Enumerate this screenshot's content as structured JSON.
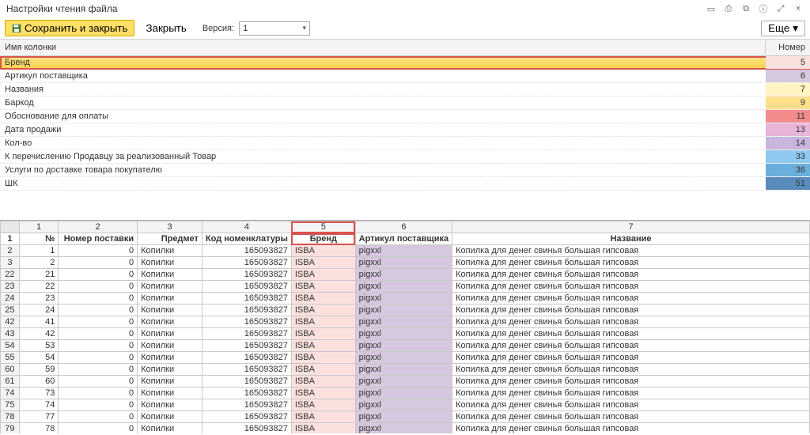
{
  "title": "Настройки чтения файла",
  "toolbar": {
    "save_label": "Сохранить и закрыть",
    "close_label": "Закрыть",
    "version_label": "Версия:",
    "version_value": "1",
    "more_label": "Еще"
  },
  "upper": {
    "header_name": "Имя колонки",
    "header_num": "Номер",
    "rows": [
      {
        "name": "Бренд",
        "num": 5,
        "color": "#fbe1de",
        "selected": true
      },
      {
        "name": "Артикул поставщика",
        "num": 6,
        "color": "#d6c8de"
      },
      {
        "name": "Названия",
        "num": 7,
        "color": "#fff4c2"
      },
      {
        "name": "Баркод",
        "num": 9,
        "color": "#ffe08a"
      },
      {
        "name": "Обоснование для оплаты",
        "num": 11,
        "color": "#f28c8c"
      },
      {
        "name": "Дата продажи",
        "num": 13,
        "color": "#e8b4d8"
      },
      {
        "name": "Кол-во",
        "num": 14,
        "color": "#c8b6de"
      },
      {
        "name": "К перечислению Продавцу за реализованный Товар",
        "num": 33,
        "color": "#8fc9f0"
      },
      {
        "name": "Услуги по доставке товара покупателю",
        "num": 36,
        "color": "#6aaedb"
      },
      {
        "name": "ШК",
        "num": 51,
        "color": "#5a8bbd"
      }
    ]
  },
  "sheet": {
    "col_numbers": [
      "1",
      "2",
      "3",
      "4",
      "5",
      "6",
      "7"
    ],
    "header_row": [
      "№",
      "Номер поставки",
      "Предмет",
      "Код номенклатуры",
      "Бренд",
      "Артикул поставщика",
      "Название"
    ],
    "data_rows": [
      {
        "r": 2,
        "c1": 1,
        "c2": 0,
        "c3": "Копилки",
        "c4": 165093827,
        "c5": "ISBA",
        "c6": "pigxxl",
        "c7": "Копилка для денег свинья большая гипсовая"
      },
      {
        "r": 3,
        "c1": 2,
        "c2": 0,
        "c3": "Копилки",
        "c4": 165093827,
        "c5": "ISBA",
        "c6": "pigxxl",
        "c7": "Копилка для денег свинья большая гипсовая"
      },
      {
        "r": 22,
        "c1": 21,
        "c2": 0,
        "c3": "Копилки",
        "c4": 165093827,
        "c5": "ISBA",
        "c6": "pigxxl",
        "c7": "Копилка для денег свинья большая гипсовая"
      },
      {
        "r": 23,
        "c1": 22,
        "c2": 0,
        "c3": "Копилки",
        "c4": 165093827,
        "c5": "ISBA",
        "c6": "pigxxl",
        "c7": "Копилка для денег свинья большая гипсовая"
      },
      {
        "r": 24,
        "c1": 23,
        "c2": 0,
        "c3": "Копилки",
        "c4": 165093827,
        "c5": "ISBA",
        "c6": "pigxxl",
        "c7": "Копилка для денег свинья большая гипсовая"
      },
      {
        "r": 25,
        "c1": 24,
        "c2": 0,
        "c3": "Копилки",
        "c4": 165093827,
        "c5": "ISBA",
        "c6": "pigxxl",
        "c7": "Копилка для денег свинья большая гипсовая"
      },
      {
        "r": 42,
        "c1": 41,
        "c2": 0,
        "c3": "Копилки",
        "c4": 165093827,
        "c5": "ISBA",
        "c6": "pigxxl",
        "c7": "Копилка для денег свинья большая гипсовая"
      },
      {
        "r": 43,
        "c1": 42,
        "c2": 0,
        "c3": "Копилки",
        "c4": 165093827,
        "c5": "ISBA",
        "c6": "pigxxl",
        "c7": "Копилка для денег свинья большая гипсовая"
      },
      {
        "r": 54,
        "c1": 53,
        "c2": 0,
        "c3": "Копилки",
        "c4": 165093827,
        "c5": "ISBA",
        "c6": "pigxxl",
        "c7": "Копилка для денег свинья большая гипсовая"
      },
      {
        "r": 55,
        "c1": 54,
        "c2": 0,
        "c3": "Копилки",
        "c4": 165093827,
        "c5": "ISBA",
        "c6": "pigxxl",
        "c7": "Копилка для денег свинья большая гипсовая"
      },
      {
        "r": 60,
        "c1": 59,
        "c2": 0,
        "c3": "Копилки",
        "c4": 165093827,
        "c5": "ISBA",
        "c6": "pigxxl",
        "c7": "Копилка для денег свинья большая гипсовая"
      },
      {
        "r": 61,
        "c1": 60,
        "c2": 0,
        "c3": "Копилки",
        "c4": 165093827,
        "c5": "ISBA",
        "c6": "pigxxl",
        "c7": "Копилка для денег свинья большая гипсовая"
      },
      {
        "r": 74,
        "c1": 73,
        "c2": 0,
        "c3": "Копилки",
        "c4": 165093827,
        "c5": "ISBA",
        "c6": "pigxxl",
        "c7": "Копилка для денег свинья большая гипсовая"
      },
      {
        "r": 75,
        "c1": 74,
        "c2": 0,
        "c3": "Копилки",
        "c4": 165093827,
        "c5": "ISBA",
        "c6": "pigxxl",
        "c7": "Копилка для денег свинья большая гипсовая"
      },
      {
        "r": 78,
        "c1": 77,
        "c2": 0,
        "c3": "Копилки",
        "c4": 165093827,
        "c5": "ISBA",
        "c6": "pigxxl",
        "c7": "Копилка для денег свинья большая гипсовая"
      },
      {
        "r": 79,
        "c1": 78,
        "c2": 0,
        "c3": "Копилки",
        "c4": 165093827,
        "c5": "ISBA",
        "c6": "pigxxl",
        "c7": "Копилка для денег свинья большая гипсовая"
      }
    ]
  }
}
